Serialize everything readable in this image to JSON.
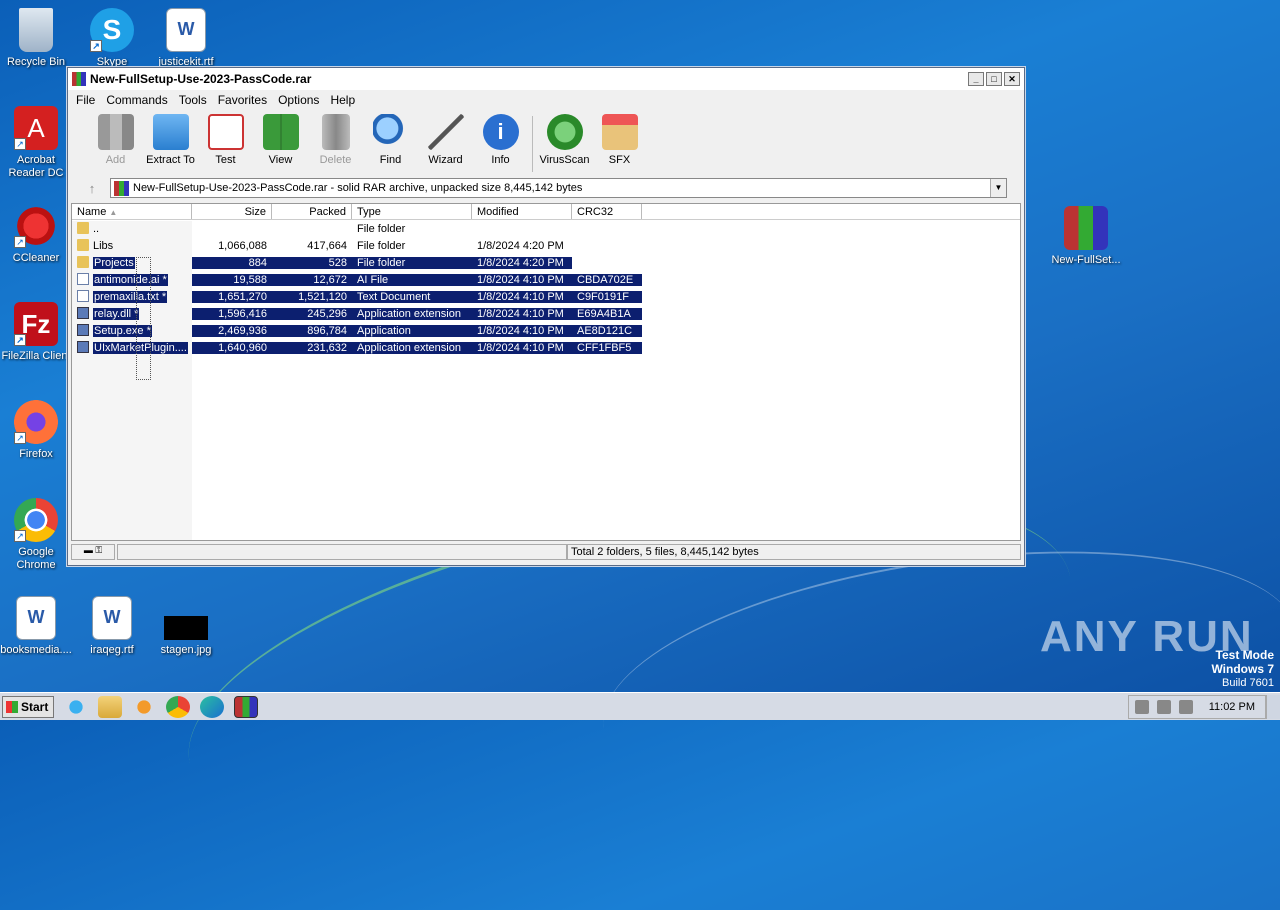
{
  "desktop": {
    "icons": [
      {
        "label": "Recycle Bin"
      },
      {
        "label": "Skype"
      },
      {
        "label": "justicekit.rtf"
      },
      {
        "label": "Acrobat Reader DC"
      },
      {
        "label": "CCleaner"
      },
      {
        "label": "FileZilla Client"
      },
      {
        "label": "Firefox"
      },
      {
        "label": "Google Chrome"
      },
      {
        "label": "booksmedia...."
      },
      {
        "label": "iraqeg.rtf"
      },
      {
        "label": "stagen.jpg"
      },
      {
        "label": "New-FullSet..."
      }
    ],
    "watermark": {
      "line1": "Test Mode",
      "line2": "Windows 7",
      "line3": "Build 7601"
    },
    "anyrun": "ANY RUN"
  },
  "window": {
    "title": "New-FullSetup-Use-2023-PassCode.rar",
    "menu": [
      "File",
      "Commands",
      "Tools",
      "Favorites",
      "Options",
      "Help"
    ],
    "toolbar": [
      {
        "label": "Add",
        "icon": "add-archive-icon",
        "disabled": true
      },
      {
        "label": "Extract To",
        "icon": "extract-folder-icon"
      },
      {
        "label": "Test",
        "icon": "test-clipboard-icon"
      },
      {
        "label": "View",
        "icon": "view-book-icon"
      },
      {
        "label": "Delete",
        "icon": "trash-icon",
        "disabled": true
      },
      {
        "label": "Find",
        "icon": "magnifier-icon"
      },
      {
        "label": "Wizard",
        "icon": "wand-icon"
      },
      {
        "label": "Info",
        "icon": "info-icon"
      },
      {
        "label": "VirusScan",
        "icon": "bug-icon"
      },
      {
        "label": "SFX",
        "icon": "sfx-box-icon"
      }
    ],
    "address": "New-FullSetup-Use-2023-PassCode.rar - solid RAR archive, unpacked size 8,445,142 bytes",
    "columns": {
      "name": "Name",
      "size": "Size",
      "packed": "Packed",
      "type": "Type",
      "modified": "Modified",
      "crc": "CRC32"
    },
    "rows": [
      {
        "name": "..",
        "size": "",
        "packed": "",
        "type": "File folder",
        "modified": "",
        "crc": "",
        "icon": "folder",
        "selected": false
      },
      {
        "name": "Libs",
        "size": "1,066,088",
        "packed": "417,664",
        "type": "File folder",
        "modified": "1/8/2024 4:20 PM",
        "crc": "",
        "icon": "folder",
        "selected": false
      },
      {
        "name": "Projects",
        "size": "884",
        "packed": "528",
        "type": "File folder",
        "modified": "1/8/2024 4:20 PM",
        "crc": "",
        "icon": "folder",
        "selected": true
      },
      {
        "name": "antimonide.ai *",
        "size": "19,588",
        "packed": "12,672",
        "type": "AI File",
        "modified": "1/8/2024 4:10 PM",
        "crc": "CBDA702E",
        "icon": "file",
        "selected": true
      },
      {
        "name": "premaxilla.txt *",
        "size": "1,651,270",
        "packed": "1,521,120",
        "type": "Text Document",
        "modified": "1/8/2024 4:10 PM",
        "crc": "C9F0191F",
        "icon": "file",
        "selected": true
      },
      {
        "name": "relay.dll *",
        "size": "1,596,416",
        "packed": "245,296",
        "type": "Application extension",
        "modified": "1/8/2024 4:10 PM",
        "crc": "E69A4B1A",
        "icon": "app",
        "selected": true
      },
      {
        "name": "Setup.exe *",
        "size": "2,469,936",
        "packed": "896,784",
        "type": "Application",
        "modified": "1/8/2024 4:10 PM",
        "crc": "AE8D121C",
        "icon": "app",
        "selected": true
      },
      {
        "name": "UIxMarketPlugin....",
        "size": "1,640,960",
        "packed": "231,632",
        "type": "Application extension",
        "modified": "1/8/2024 4:10 PM",
        "crc": "CFF1FBF5",
        "icon": "app",
        "selected": true
      }
    ],
    "status": "Total 2 folders, 5 files, 8,445,142 bytes"
  },
  "taskbar": {
    "start": "Start",
    "clock": "11:02 PM"
  }
}
